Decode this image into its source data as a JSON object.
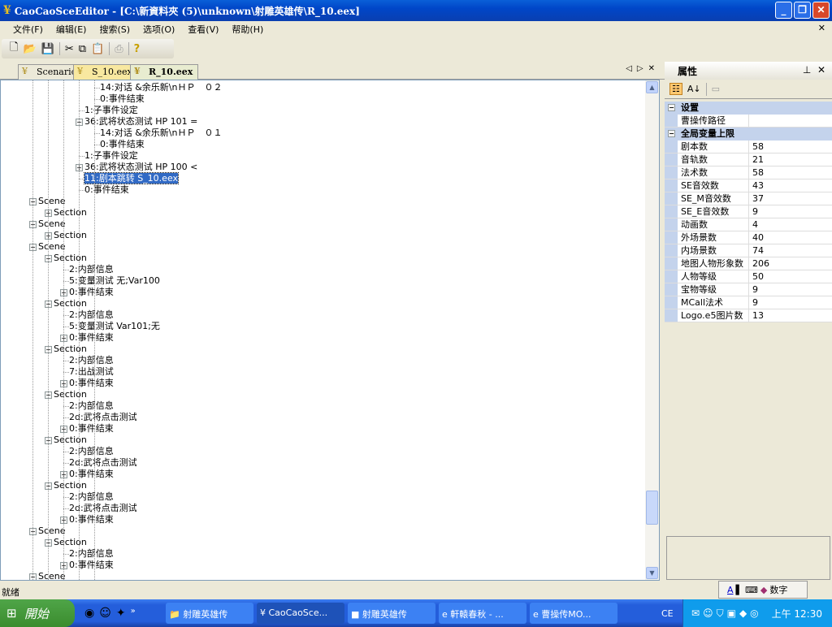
{
  "window": {
    "title": "CaoCaoSceEditor - [C:\\新資料夾 (5)\\unknown\\射雕英雄传\\R_10.eex]"
  },
  "menu": [
    "文件(F)",
    "编辑(E)",
    "搜索(S)",
    "选项(O)",
    "查看(V)",
    "帮助(H)"
  ],
  "toolbar": [
    {
      "icon": "new-file-icon",
      "glyph": "🗋"
    },
    {
      "icon": "open-folder-icon",
      "glyph": "📂"
    },
    {
      "icon": "save-icon",
      "glyph": "💾"
    },
    {
      "icon": "cut-icon",
      "glyph": "✂"
    },
    {
      "icon": "copy-icon",
      "glyph": "⧉"
    },
    {
      "icon": "paste-icon",
      "glyph": "📋"
    },
    {
      "icon": "print-icon",
      "glyph": "⎙"
    },
    {
      "icon": "help-icon",
      "glyph": "?"
    }
  ],
  "tabs": [
    {
      "label": "Scenario"
    },
    {
      "label": "S_10.eex"
    },
    {
      "label": "R_10.eex"
    }
  ],
  "tree": [
    {
      "l": 4,
      "t": "14:对话 &余乐新\\nＨＰ　０２"
    },
    {
      "l": 4,
      "t": "0:事件结束"
    },
    {
      "l": 3,
      "t": "1:子事件设定"
    },
    {
      "l": 3,
      "e": "-",
      "t": "36:武将状态测试  HP 101 ="
    },
    {
      "l": 4,
      "t": "14:对话 &余乐新\\nＨＰ　０１"
    },
    {
      "l": 4,
      "t": "0:事件结束"
    },
    {
      "l": 3,
      "t": "1:子事件设定"
    },
    {
      "l": 3,
      "e": "+",
      "t": "36:武将状态测试  HP 100 <"
    },
    {
      "l": 3,
      "t": "11:剧本跳转 S_10.eex",
      "sel": true
    },
    {
      "l": 3,
      "t": "0:事件结束"
    },
    {
      "l": 0,
      "e": "-",
      "t": "Scene"
    },
    {
      "l": 1,
      "e": "+",
      "t": "Section"
    },
    {
      "l": 0,
      "e": "-",
      "t": "Scene"
    },
    {
      "l": 1,
      "e": "+",
      "t": "Section"
    },
    {
      "l": 0,
      "e": "-",
      "t": "Scene"
    },
    {
      "l": 1,
      "e": "-",
      "t": "Section"
    },
    {
      "l": 2,
      "t": "2:内部信息"
    },
    {
      "l": 2,
      "t": "5:变量测试 无;Var100"
    },
    {
      "l": 2,
      "e": "+",
      "t": "0:事件结束"
    },
    {
      "l": 1,
      "e": "-",
      "t": "Section"
    },
    {
      "l": 2,
      "t": "2:内部信息"
    },
    {
      "l": 2,
      "t": "5:变量测试 Var101;无"
    },
    {
      "l": 2,
      "e": "+",
      "t": "0:事件结束"
    },
    {
      "l": 1,
      "e": "-",
      "t": "Section"
    },
    {
      "l": 2,
      "t": "2:内部信息"
    },
    {
      "l": 2,
      "t": "7:出战测试"
    },
    {
      "l": 2,
      "e": "+",
      "t": "0:事件结束"
    },
    {
      "l": 1,
      "e": "-",
      "t": "Section"
    },
    {
      "l": 2,
      "t": "2:内部信息"
    },
    {
      "l": 2,
      "t": "2d:武将点击测试"
    },
    {
      "l": 2,
      "e": "+",
      "t": "0:事件结束"
    },
    {
      "l": 1,
      "e": "-",
      "t": "Section"
    },
    {
      "l": 2,
      "t": "2:内部信息"
    },
    {
      "l": 2,
      "t": "2d:武将点击测试"
    },
    {
      "l": 2,
      "e": "+",
      "t": "0:事件结束"
    },
    {
      "l": 1,
      "e": "-",
      "t": "Section"
    },
    {
      "l": 2,
      "t": "2:内部信息"
    },
    {
      "l": 2,
      "t": "2d:武将点击测试"
    },
    {
      "l": 2,
      "e": "+",
      "t": "0:事件结束"
    },
    {
      "l": 0,
      "e": "-",
      "t": "Scene"
    },
    {
      "l": 1,
      "e": "-",
      "t": "Section"
    },
    {
      "l": 2,
      "t": "2:内部信息"
    },
    {
      "l": 2,
      "e": "+",
      "t": "0:事件结束"
    },
    {
      "l": 0,
      "e": "-",
      "t": "Scene"
    }
  ],
  "properties": {
    "title": "属性",
    "categories": [
      {
        "name": "设置",
        "rows": [
          {
            "k": "曹操传路径",
            "v": ""
          }
        ]
      },
      {
        "name": "全局变量上限",
        "rows": [
          {
            "k": "剧本数",
            "v": "58"
          },
          {
            "k": "音轨数",
            "v": "21"
          },
          {
            "k": "法术数",
            "v": "58"
          },
          {
            "k": "SE音效数",
            "v": "43"
          },
          {
            "k": "SE_M音效数",
            "v": "37"
          },
          {
            "k": "SE_E音效数",
            "v": "9"
          },
          {
            "k": "动画数",
            "v": "4"
          },
          {
            "k": "外场景数",
            "v": "40"
          },
          {
            "k": "内场景数",
            "v": "74"
          },
          {
            "k": "地图人物形象数",
            "v": "206"
          },
          {
            "k": "人物等级",
            "v": "50"
          },
          {
            "k": "宝物等级",
            "v": "9"
          },
          {
            "k": "MCall法术",
            "v": "9"
          },
          {
            "k": "Logo.e5图片数",
            "v": "13"
          }
        ]
      }
    ]
  },
  "status": {
    "text": "就绪",
    "ime": "数字"
  },
  "taskbar": {
    "start": "開始",
    "tasks": [
      "射雕英雄传",
      "CaoCaoSce...",
      "射雕英雄传",
      "軒轅春秋 - ...",
      "曹操传MO..."
    ],
    "lang": "CE",
    "clock": "上午 12:30"
  }
}
